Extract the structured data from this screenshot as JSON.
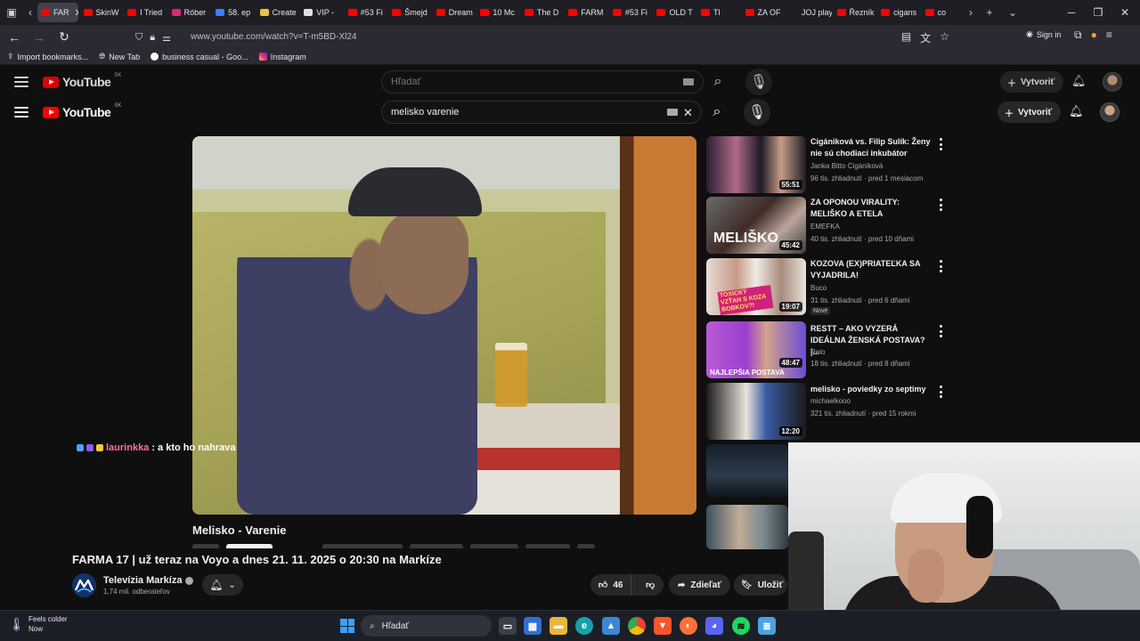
{
  "browser": {
    "tabs": [
      {
        "label": "FAR",
        "color": "#ff0000",
        "active": true
      },
      {
        "label": "SkinW",
        "color": "#ff0000"
      },
      {
        "label": "I Tried",
        "color": "#ff0000"
      },
      {
        "label": "Róber",
        "color": "#d62976"
      },
      {
        "label": "58. ep",
        "color": "#3d7dff"
      },
      {
        "label": "Create",
        "color": "#e8c24a"
      },
      {
        "label": "VIP - ",
        "color": "#e0e0e0"
      },
      {
        "label": "#53 Fi",
        "color": "#ff0000"
      },
      {
        "label": "Šmejd",
        "color": "#ff0000"
      },
      {
        "label": "Dream",
        "color": "#ff0000"
      },
      {
        "label": "10 Mc",
        "color": "#ff0000"
      },
      {
        "label": "The D",
        "color": "#ff0000"
      },
      {
        "label": "FARM",
        "color": "#ff0000"
      },
      {
        "label": "#53 Fi",
        "color": "#ff0000"
      },
      {
        "label": "OLD T",
        "color": "#ff0000"
      },
      {
        "label": "Tl",
        "color": "#ff0000"
      },
      {
        "label": "ZA OF",
        "color": "#ff0000"
      },
      {
        "label": "JOJ play",
        "color": "#1f1e25"
      },
      {
        "label": "Řezník",
        "color": "#ff0000"
      },
      {
        "label": "cigans",
        "color": "#ff0000"
      },
      {
        "label": "co",
        "color": "#ff0000"
      }
    ],
    "url": "www.youtube.com/watch?v=T-m5BD-Xl24",
    "signin_label": "Sign in",
    "bookmarks": [
      {
        "label": "Import bookmarks...",
        "icon": "import-icon"
      },
      {
        "label": "New Tab",
        "icon": "globe-icon"
      },
      {
        "label": "business casual - Goo...",
        "icon": "google-icon"
      },
      {
        "label": "Instagram",
        "icon": "instagram-icon"
      }
    ]
  },
  "youtube": {
    "logo_text": "YouTube",
    "country_code": "SK",
    "search_placeholder": "Hľadať",
    "search_query": "melisko varenie",
    "create_label": "Vytvoriť"
  },
  "player": {
    "chat_user": "laurinkka",
    "chat_message": ": a kto ho nahrava",
    "inner_title": "Melisko - Varenie"
  },
  "recommendations": [
    {
      "title": "Cigániková vs. Filip Sulík: Ženy nie sú chodiaci inkubátor",
      "channel": "Janka Bitto Cigániková",
      "meta": "96 tis. zhliadnutí · pred 1 mesiacom",
      "duration": "55:51",
      "badge": ""
    },
    {
      "title": "ZA OPONOU VIRALITY: MELIŠKO A ETELA",
      "channel": "EMEFKA",
      "meta": "40 tis. zhliadnutí · pred 10 dňami",
      "duration": "45:42",
      "badge": "",
      "thumb_text": "MELIŠKO"
    },
    {
      "title": "KOZOVA (EX)PRIATEĽKA SA VYJADRILA!",
      "channel": "Buco",
      "meta": "31 tis. zhliadnutí · pred 6 dňami",
      "duration": "19:07",
      "badge": "Nové",
      "thumb_text": "TOXICKÝ VZŤAH S KOZA BOBKOV?!"
    },
    {
      "title": "RESTT – AKO VYZERÁ IDEÁLNA ŽENSKÁ POSTAVA? |...",
      "channel": "Relo",
      "meta": "18 tis. zhliadnutí · pred 8 dňami",
      "duration": "48:47",
      "badge": "",
      "thumb_text": "NAJLEPŠIA POSTAVA"
    },
    {
      "title": "melisko - poviedky zo septimy",
      "channel": "michaelkooo",
      "meta": "321 tis. zhliadnutí · pred 15 rokmi",
      "duration": "12:20",
      "badge": ""
    }
  ],
  "video": {
    "title": "FARMA 17 | už teraz na Voyo a dnes 21. 11. 2025 o 20:30 na Markíze",
    "channel": "Televízia Markíza",
    "subscribers": "1,74 mil. odberateľov",
    "likes": "46",
    "share_label": "Zdieľať",
    "save_label": "Uložiť"
  },
  "taskbar": {
    "weather_line1": "Feels colder",
    "weather_line2": "Now",
    "search_label": "Hľadať"
  }
}
